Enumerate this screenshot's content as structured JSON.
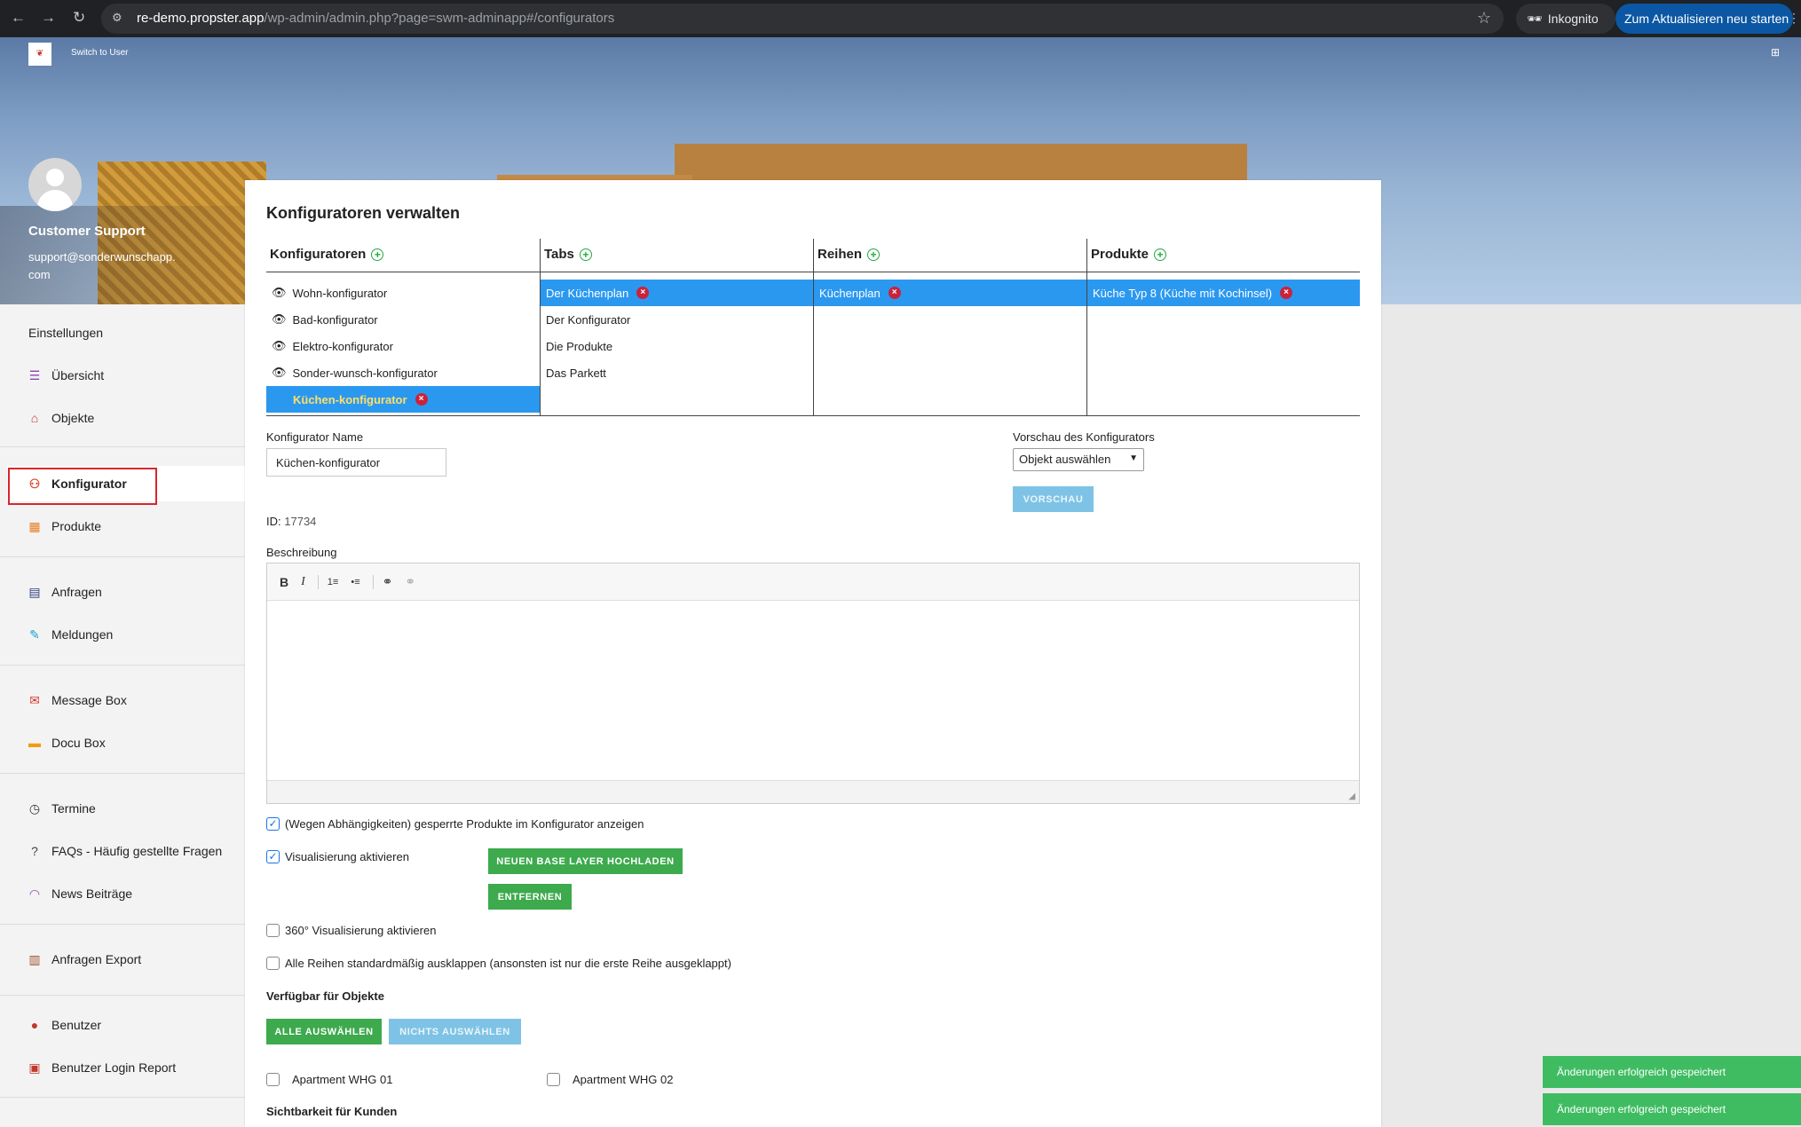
{
  "browser": {
    "url_host": "re-demo.propster.app",
    "url_path": "/wp-admin/admin.php?page=swm-adminapp#/configurators",
    "incognito_label": "Inkognito",
    "update_label": "Zum Aktualisieren neu starten"
  },
  "topbar": {
    "switch_user": "Switch to User"
  },
  "user": {
    "name": "Customer Support",
    "email": "support@sonderwunschapp.com"
  },
  "sidebar": {
    "settings": "Einstellungen",
    "items": [
      {
        "label": "Übersicht",
        "icon": "list-icon"
      },
      {
        "label": "Objekte",
        "icon": "home-icon"
      },
      {
        "label": "Konfigurator",
        "icon": "sitemap-icon"
      },
      {
        "label": "Produkte",
        "icon": "products-icon"
      },
      {
        "label": "Anfragen",
        "icon": "inbox-icon"
      },
      {
        "label": "Meldungen",
        "icon": "edit-icon"
      },
      {
        "label": "Message Box",
        "icon": "message-icon"
      },
      {
        "label": "Docu Box",
        "icon": "folder-icon"
      },
      {
        "label": "Termine",
        "icon": "clock-icon"
      },
      {
        "label": "FAQs - Häufig gestellte Fragen",
        "icon": "question-icon"
      },
      {
        "label": "News Beiträge",
        "icon": "rss-icon"
      },
      {
        "label": "Anfragen Export",
        "icon": "file-export-icon"
      },
      {
        "label": "Benutzer",
        "icon": "user-icon"
      },
      {
        "label": "Benutzer Login Report",
        "icon": "report-icon"
      }
    ]
  },
  "main": {
    "title": "Konfiguratoren verwalten",
    "columns": {
      "konfiguratoren": {
        "header": "Konfiguratoren",
        "items": [
          "Wohn-konfigurator",
          "Bad-konfigurator",
          "Elektro-konfigurator",
          "Sonder-wunsch-konfigurator"
        ],
        "selected": "Küchen-konfigurator"
      },
      "tabs": {
        "header": "Tabs",
        "selected": "Der Küchenplan",
        "items": [
          "Der Konfigurator",
          "Die Produkte",
          "Das Parkett"
        ]
      },
      "reihen": {
        "header": "Reihen",
        "selected": "Küchenplan"
      },
      "produkte": {
        "header": "Produkte",
        "selected": "Küche Typ 8 (Küche mit Kochinsel)"
      }
    },
    "form": {
      "name_label": "Konfigurator Name",
      "name_value": "Küchen-konfigurator",
      "preview_label": "Vorschau des Konfigurators",
      "preview_select": "Objekt auswählen",
      "preview_button": "VORSCHAU",
      "id_label": "ID:",
      "id_value": "17734",
      "description_label": "Beschreibung",
      "toolbar": {
        "bold": "B",
        "italic": "I",
        "ol": "1≡",
        "ul": "•≡",
        "link": "⚭",
        "unlink": "⚭"
      },
      "cb_locked": "(Wegen Abhängigkeiten) gesperrte Produkte im Konfigurator anzeigen",
      "cb_visual": "Visualisierung aktivieren",
      "btn_upload": "NEUEN BASE LAYER HOCHLADEN",
      "btn_remove": "ENTFERNEN",
      "cb_360": "360° Visualisierung aktivieren",
      "cb_expand": "Alle Reihen standardmäßig ausklappen (ansonsten ist nur die erste Reihe ausgeklappt)",
      "available_heading": "Verfügbar für Objekte",
      "btn_all": "ALLE AUSWÄHLEN",
      "btn_none": "NICHTS AUSWÄHLEN",
      "objects": [
        "Apartment WHG 01",
        "Apartment WHG 02"
      ],
      "visibility_heading": "Sichtbarkeit für Kunden"
    }
  },
  "toasts": [
    "Änderungen erfolgreich gespeichert",
    "Änderungen erfolgreich gespeichert"
  ]
}
